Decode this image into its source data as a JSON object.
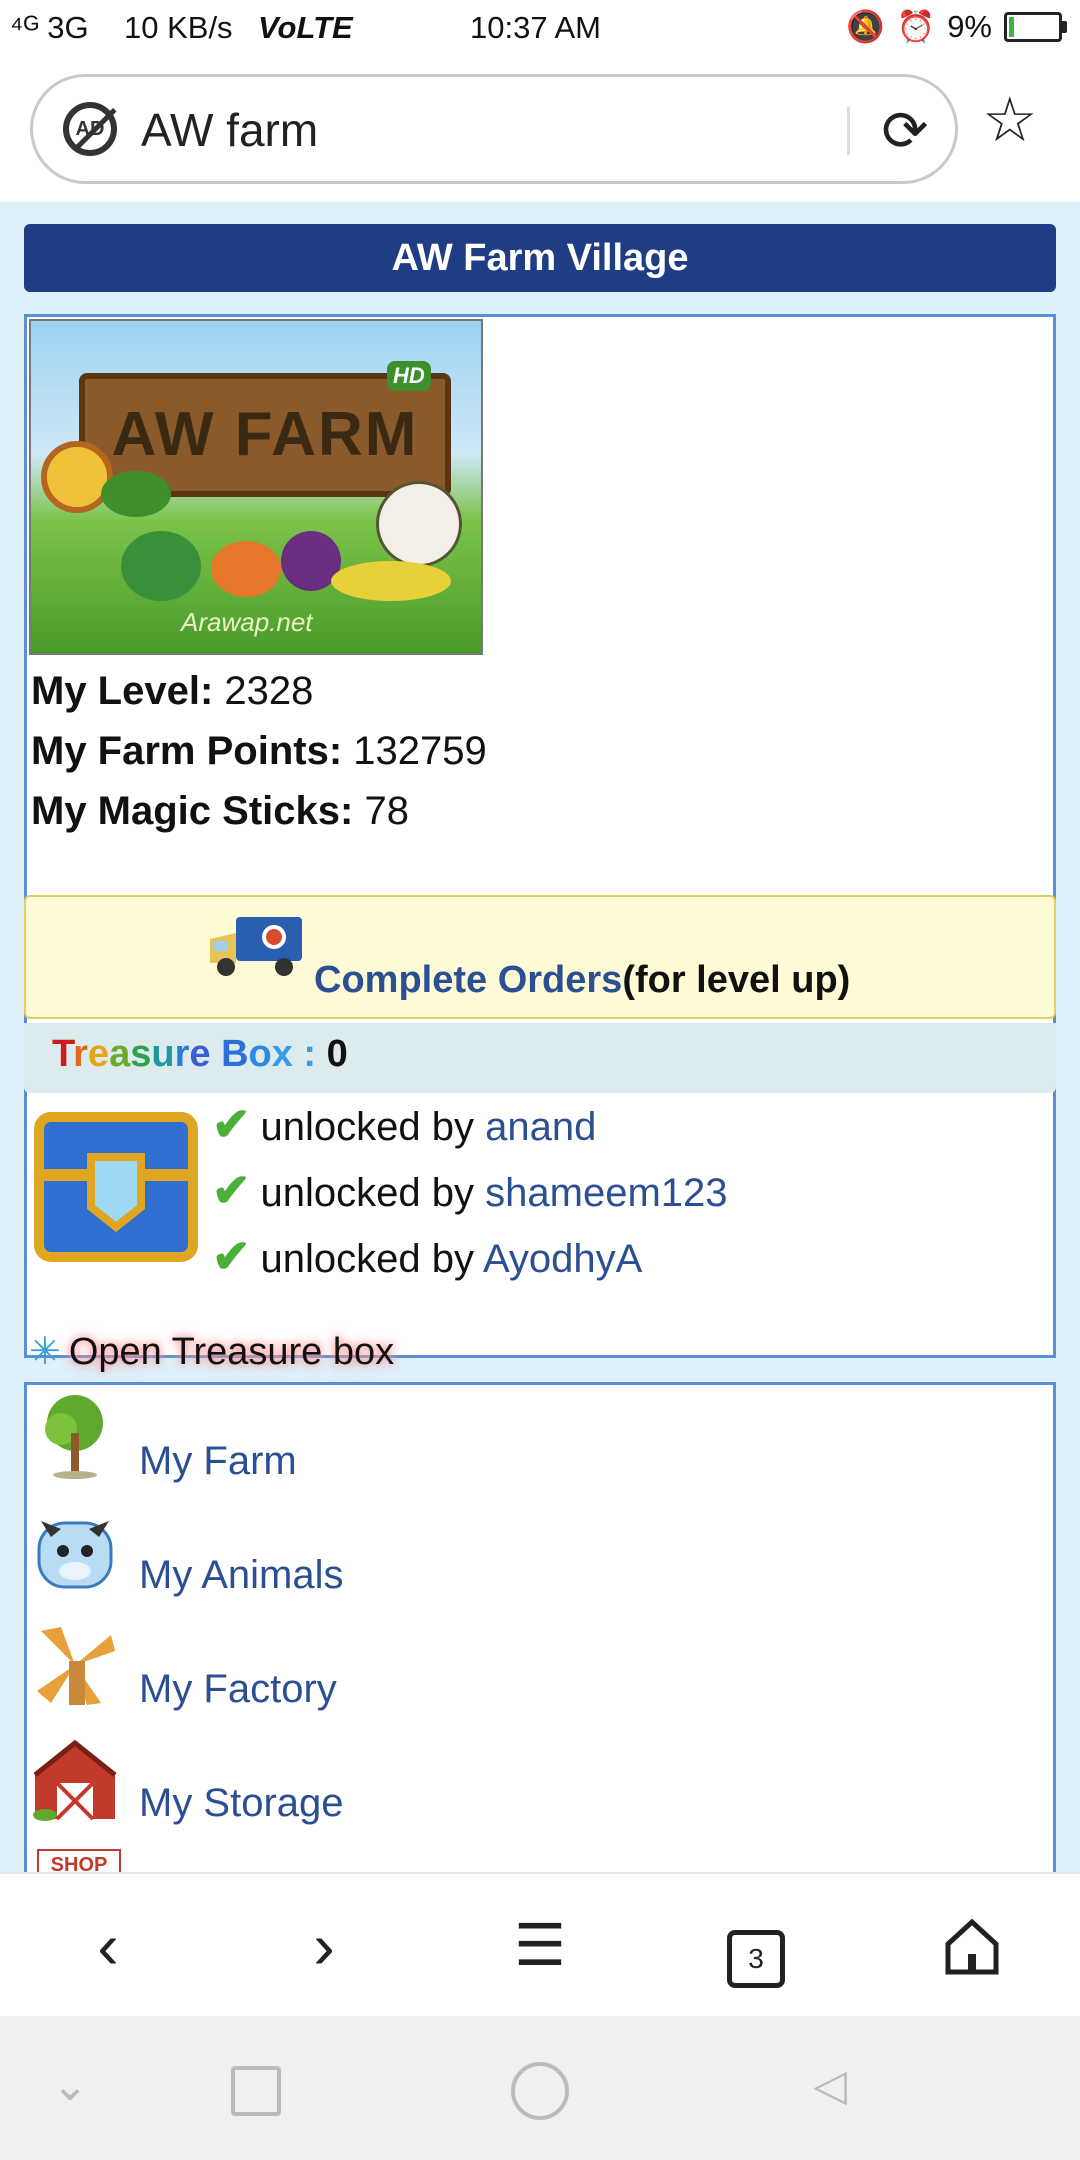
{
  "status_bar": {
    "signal": "⁴ᴳ 3G",
    "speed": "10 KB/s",
    "network": "VoLTE",
    "time": "10:37 AM",
    "battery": "9%",
    "battery_level": 0.09
  },
  "address_bar": {
    "url_text": "AW farm",
    "adblock_label": "AD"
  },
  "page": {
    "title": "AW Farm Village",
    "logo": {
      "title": "AW FARM",
      "badge": "HD",
      "credit": "Arawap.net"
    },
    "stats": [
      {
        "label": "My Level:",
        "value": "2328"
      },
      {
        "label": "My Farm Points:",
        "value": "132759"
      },
      {
        "label": "My Magic Sticks:",
        "value": "78"
      }
    ],
    "orders": {
      "link": "Complete Orders",
      "suffix": "(for level up)"
    },
    "treasure": {
      "title_letters": [
        "T",
        "r",
        "e",
        "a",
        "s",
        "u",
        "r",
        "e",
        " ",
        "B",
        "o",
        "x"
      ],
      "title_colors": [
        "#cc1b1b",
        "#e06a1a",
        "#e3a51a",
        "#6aa92b",
        "#2fa24a",
        "#1c9aa0",
        "#2a7fd3",
        "#3a5fd0",
        "#ffffff",
        "#2d6fd6",
        "#2f88e0",
        "#3a9be6"
      ],
      "separator": " : ",
      "count": "0",
      "unlocks": [
        {
          "text": "unlocked by",
          "user": "anand"
        },
        {
          "text": "unlocked by",
          "user": "shameem123"
        },
        {
          "text": "unlocked by",
          "user": "AyodhyA"
        }
      ],
      "open_label": "Open Treasure box"
    },
    "menu": [
      {
        "label": "My Farm",
        "icon": "tree-icon"
      },
      {
        "label": "My Animals",
        "icon": "cow-icon"
      },
      {
        "label": "My Factory",
        "icon": "windmill-icon"
      },
      {
        "label": "My Storage",
        "icon": "barn-icon"
      },
      {
        "label": "SHOP",
        "icon": "shop-icon"
      }
    ]
  },
  "bottom_nav": {
    "tabs_count": "3"
  },
  "colors": {
    "header_blue": "#1f3d84",
    "link_blue": "#2b4f93",
    "panel_border": "#5b8fd3",
    "page_bg": "#ddf0fb",
    "orders_bg": "#fffbd6"
  }
}
